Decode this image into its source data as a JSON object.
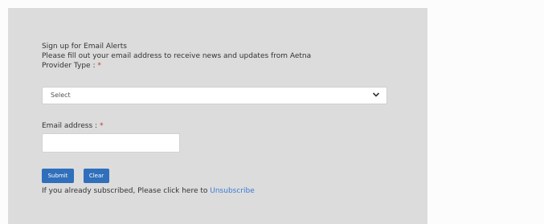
{
  "form": {
    "heading": "Sign up for Email Alerts",
    "description": "Please fill out your email address to receive news and updates from Aetna",
    "provider_type": {
      "label": "Provider Type : ",
      "required_mark": "*",
      "selected": "Select"
    },
    "email": {
      "label": "Email address : ",
      "required_mark": "*",
      "value": ""
    },
    "buttons": {
      "submit": "Submit",
      "clear": "Clear"
    },
    "footer": {
      "text": "If you already subscribed, Please click here to ",
      "link": "Unsubscribe"
    }
  },
  "icons": {
    "select_chevron": "chevron-down-icon"
  },
  "colors": {
    "panel_background": "#dcdcdc",
    "button": "#2f6fbb",
    "link": "#3a7bd5",
    "required": "#c0392b"
  }
}
